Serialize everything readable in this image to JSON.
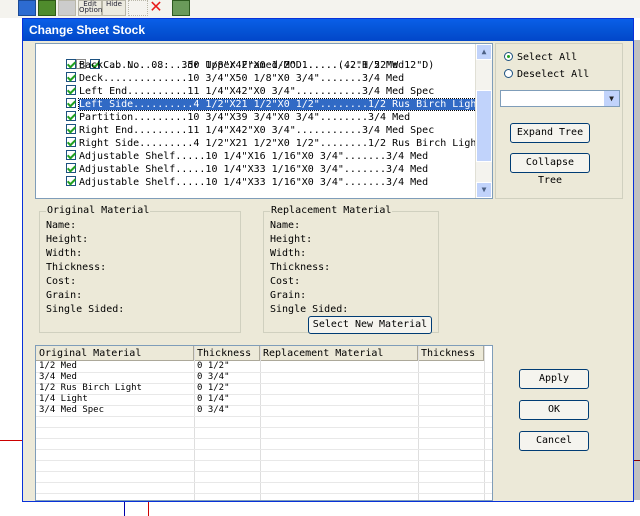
{
  "toolbar": {
    "opts_label": "Edit Options",
    "hide_label": "Hide"
  },
  "dialog": {
    "title": "Change Sheet Stock"
  },
  "tree": {
    "root": "Cab No. 08:  3dr Upper Framed-MOD1.....(42\"H 52\"W 12\"D)",
    "items": [
      "Back..............50 1/8\"X42\"X0 1/2\"...........1/2 Med",
      "Deck..............10 3/4\"X50 1/8\"X0 3/4\".......3/4 Med",
      "Left End..........11 1/4\"X42\"X0 3/4\"...........3/4 Med Spec",
      "Left Side..........4 1/2\"X21 1/2\"X0 1/2\"........1/2 Rus Birch Light",
      "Partition.........10 3/4\"X39 3/4\"X0 3/4\"........3/4 Med",
      "Right End.........11 1/4\"X42\"X0 3/4\"...........3/4 Med Spec",
      "Right Side.........4 1/2\"X21 1/2\"X0 1/2\"........1/2 Rus Birch Light",
      "Adjustable Shelf.....10 1/4\"X16 1/16\"X0 3/4\".......3/4 Med",
      "Adjustable Shelf.....10 1/4\"X33 1/16\"X0 3/4\".......3/4 Med",
      "Adjustable Shelf.....10 1/4\"X33 1/16\"X0 3/4\".......3/4 Med"
    ],
    "selected_index": 3
  },
  "right_panel": {
    "select_all": "Select All",
    "deselect_all": "Deselect All",
    "dropdown_value": "",
    "expand_tree": "Expand Tree",
    "collapse_tree": "Collapse Tree"
  },
  "original_material": {
    "legend": "Original Material",
    "fields": [
      "Name:",
      "Height:",
      "Width:",
      "Thickness:",
      "Cost:",
      "Grain:",
      "Single Sided:"
    ]
  },
  "replacement_material": {
    "legend": "Replacement Material",
    "fields": [
      "Name:",
      "Height:",
      "Width:",
      "Thickness:",
      "Cost:",
      "Grain:",
      "Single Sided:"
    ],
    "select_button": "Select New Material"
  },
  "grid": {
    "headers": [
      "Original Material",
      "Thickness",
      "Replacement Material",
      "Thickness"
    ],
    "rows": [
      [
        "1/2 Med",
        "0 1/2\"",
        "",
        ""
      ],
      [
        "3/4 Med",
        "0 3/4\"",
        "",
        ""
      ],
      [
        "1/2 Rus Birch Light",
        "0 1/2\"",
        "",
        ""
      ],
      [
        "1/4 Light",
        "0 1/4\"",
        "",
        ""
      ],
      [
        "3/4 Med Spec",
        "0 3/4\"",
        "",
        ""
      ]
    ]
  },
  "actions": {
    "apply": "Apply",
    "ok": "OK",
    "cancel": "Cancel"
  }
}
